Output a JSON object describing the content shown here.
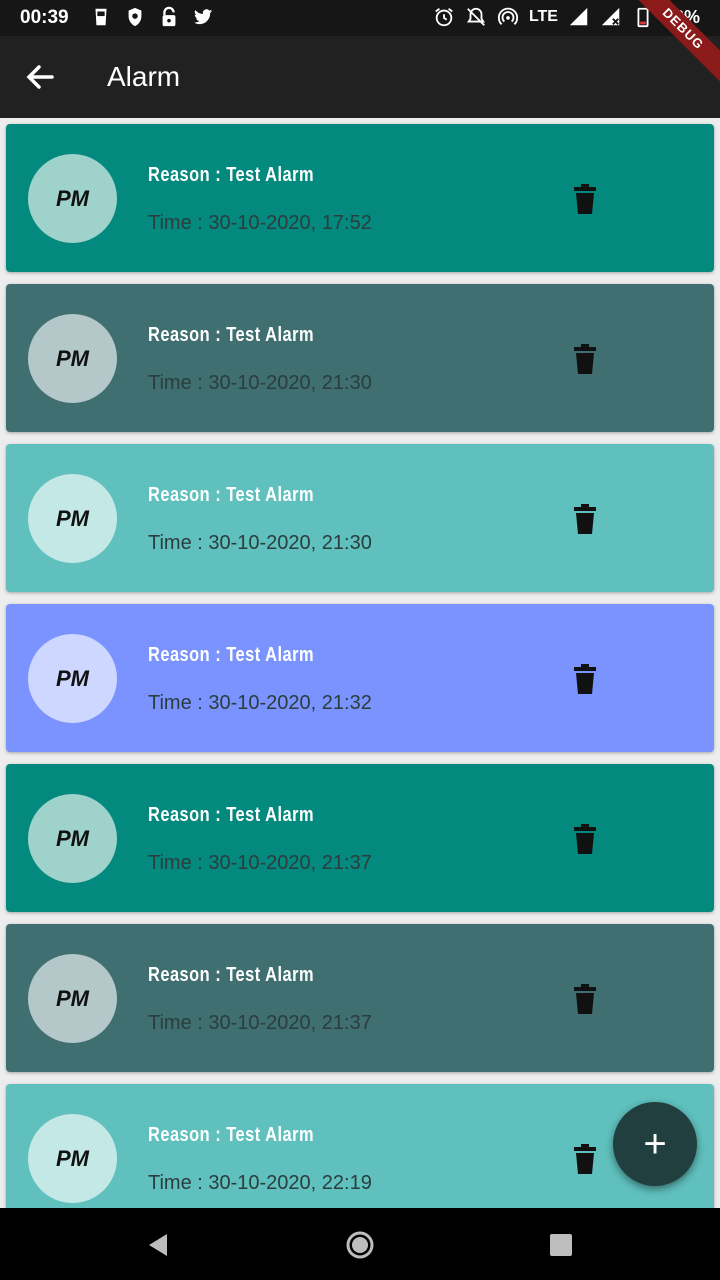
{
  "status_bar": {
    "time": "00:39",
    "network": "LTE",
    "battery": "12%",
    "icons_left": [
      "sim-icon",
      "shield-icon",
      "lock-icon",
      "twitter-icon"
    ],
    "icons_right": [
      "alarm-icon",
      "notifications-off-icon",
      "hotspot-icon",
      "signal-icon",
      "signal-icon",
      "battery-icon"
    ]
  },
  "debug_banner": "DEBUG",
  "app_bar": {
    "title": "Alarm"
  },
  "alarms": [
    {
      "avatar": "PM",
      "reason": "Reason : Test Alarm",
      "time": "Time : 30-10-2020, 17:52",
      "card_color": "#04897e",
      "avatar_color": "#9fd2ca"
    },
    {
      "avatar": "PM",
      "reason": "Reason : Test Alarm",
      "time": "Time : 30-10-2020, 21:30",
      "card_color": "#3f6f70",
      "avatar_color": "#b4c8c9"
    },
    {
      "avatar": "PM",
      "reason": "Reason : Test Alarm",
      "time": "Time : 30-10-2020, 21:30",
      "card_color": "#5fc0bd",
      "avatar_color": "#c3e8e6"
    },
    {
      "avatar": "PM",
      "reason": "Reason : Test Alarm",
      "time": "Time : 30-10-2020, 21:32",
      "card_color": "#7a93ff",
      "avatar_color": "#cdd7ff"
    },
    {
      "avatar": "PM",
      "reason": "Reason : Test Alarm",
      "time": "Time : 30-10-2020, 21:37",
      "card_color": "#04897e",
      "avatar_color": "#9fd2ca"
    },
    {
      "avatar": "PM",
      "reason": "Reason : Test Alarm",
      "time": "Time : 30-10-2020, 21:37",
      "card_color": "#3f6f70",
      "avatar_color": "#b4c8c9"
    },
    {
      "avatar": "PM",
      "reason": "Reason : Test Alarm",
      "time": "Time : 30-10-2020, 22:19",
      "card_color": "#5fc0bd",
      "avatar_color": "#c3e8e6"
    }
  ],
  "fab": {
    "label": "+"
  }
}
